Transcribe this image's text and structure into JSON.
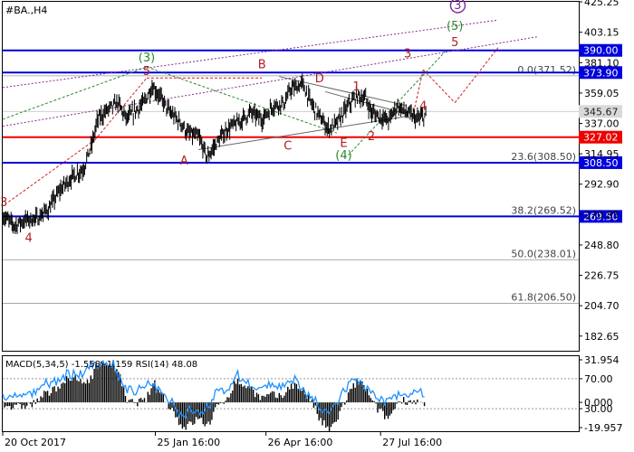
{
  "symbol_label": "#BA.,H4",
  "chart_data": {
    "type": "line",
    "title": "#BA.,H4",
    "price_axis": {
      "ylim": [
        172.0,
        425.25
      ],
      "ticks": [
        425.25,
        403.15,
        381.1,
        359.05,
        337.0,
        314.95,
        292.9,
        270.85,
        248.8,
        226.75,
        204.7,
        182.65
      ]
    },
    "x_labels": [
      {
        "label": "20 Oct 2017",
        "t": 0.0
      },
      {
        "label": "25 Jan 16:00",
        "t": 0.265
      },
      {
        "label": "26 Apr 16:00",
        "t": 0.457
      },
      {
        "label": "27 Jul 16:00",
        "t": 0.656
      }
    ],
    "price_series": [
      [
        0.0,
        270
      ],
      [
        0.02,
        263
      ],
      [
        0.04,
        267
      ],
      [
        0.06,
        268
      ],
      [
        0.08,
        275
      ],
      [
        0.1,
        289
      ],
      [
        0.12,
        298
      ],
      [
        0.14,
        304
      ],
      [
        0.155,
        322
      ],
      [
        0.165,
        340
      ],
      [
        0.18,
        346
      ],
      [
        0.2,
        352
      ],
      [
        0.215,
        340
      ],
      [
        0.23,
        346
      ],
      [
        0.245,
        352
      ],
      [
        0.26,
        364
      ],
      [
        0.275,
        355
      ],
      [
        0.29,
        345
      ],
      [
        0.31,
        337
      ],
      [
        0.32,
        330
      ],
      [
        0.34,
        327
      ],
      [
        0.355,
        312
      ],
      [
        0.37,
        322
      ],
      [
        0.39,
        333
      ],
      [
        0.41,
        338
      ],
      [
        0.43,
        345
      ],
      [
        0.45,
        340
      ],
      [
        0.47,
        350
      ],
      [
        0.49,
        352
      ],
      [
        0.5,
        362
      ],
      [
        0.51,
        363
      ],
      [
        0.52,
        366
      ],
      [
        0.535,
        352
      ],
      [
        0.55,
        342
      ],
      [
        0.565,
        333
      ],
      [
        0.58,
        337
      ],
      [
        0.6,
        350
      ],
      [
        0.615,
        357
      ],
      [
        0.63,
        355
      ],
      [
        0.64,
        345
      ],
      [
        0.655,
        342
      ],
      [
        0.67,
        339
      ],
      [
        0.685,
        350
      ],
      [
        0.7,
        345
      ],
      [
        0.72,
        340
      ],
      [
        0.735,
        343
      ]
    ],
    "horizontal_lines": [
      {
        "price": 390.0,
        "label": "390.00",
        "color": "#0000dd",
        "style": "solid"
      },
      {
        "price": 373.9,
        "label": "373.90",
        "color": "#0000dd",
        "style": "solid"
      },
      {
        "price": 327.02,
        "label": "327.02",
        "color": "#ee0000",
        "style": "solid"
      },
      {
        "price": 308.5,
        "label": "308.50",
        "color": "#0000dd",
        "style": "solid"
      },
      {
        "price": 269.5,
        "label": "269.50",
        "color": "#0000dd",
        "style": "solid"
      }
    ],
    "current_price": {
      "price": 345.67,
      "label": "345.67"
    },
    "fibonacci_levels": [
      {
        "price": 371.52,
        "label": "0.0(371.52)"
      },
      {
        "price": 308.5,
        "label": "23.6(308.50)"
      },
      {
        "price": 269.52,
        "label": "38.2(269.52)"
      },
      {
        "price": 238.01,
        "label": "50.0(238.01)"
      },
      {
        "price": 206.5,
        "label": "61.8(206.50)"
      }
    ],
    "wave_labels": [
      {
        "text": "3",
        "t": 0.002,
        "price": 277,
        "color": "#b02020",
        "circled": false
      },
      {
        "text": "4",
        "t": 0.045,
        "price": 251,
        "color": "#b02020",
        "circled": false
      },
      {
        "text": "(3)",
        "t": 0.25,
        "price": 382,
        "color": "#2a8a2a",
        "circled": false
      },
      {
        "text": "5",
        "t": 0.25,
        "price": 372,
        "color": "#b02020",
        "circled": false
      },
      {
        "text": "A",
        "t": 0.315,
        "price": 307,
        "color": "#b02020",
        "circled": false
      },
      {
        "text": "B",
        "t": 0.45,
        "price": 377,
        "color": "#b02020",
        "circled": false
      },
      {
        "text": "C",
        "t": 0.495,
        "price": 318,
        "color": "#b02020",
        "circled": false
      },
      {
        "text": "D",
        "t": 0.55,
        "price": 367,
        "color": "#b02020",
        "circled": false
      },
      {
        "text": "E",
        "t": 0.592,
        "price": 320,
        "color": "#b02020",
        "circled": false
      },
      {
        "text": "(4)",
        "t": 0.592,
        "price": 311,
        "color": "#2a8a2a",
        "circled": false
      },
      {
        "text": "1",
        "t": 0.614,
        "price": 361,
        "color": "#b02020",
        "circled": false
      },
      {
        "text": "2",
        "t": 0.64,
        "price": 325,
        "color": "#b02020",
        "circled": false
      },
      {
        "text": "3",
        "t": 0.703,
        "price": 385,
        "color": "#b02020",
        "circled": false
      },
      {
        "text": "4",
        "t": 0.73,
        "price": 347,
        "color": "#b02020",
        "circled": false
      },
      {
        "text": "5",
        "t": 0.785,
        "price": 393,
        "color": "#b02020",
        "circled": false
      },
      {
        "text": "(5)",
        "t": 0.785,
        "price": 405,
        "color": "#2a8a2a",
        "circled": false
      },
      {
        "text": "3",
        "t": 0.79,
        "price": 420,
        "color": "#7a2a9a",
        "circled": true
      }
    ],
    "indicator": {
      "header": "MACD(5,34,5) -1.558 -1.159 RSI(14) 48.08",
      "ticks": [
        "31.954",
        "70.00",
        "0.000",
        "30.00",
        "-19.957"
      ],
      "rsi_levels": [
        70,
        30
      ],
      "macd_range": [
        -19.957,
        31.954
      ]
    }
  }
}
